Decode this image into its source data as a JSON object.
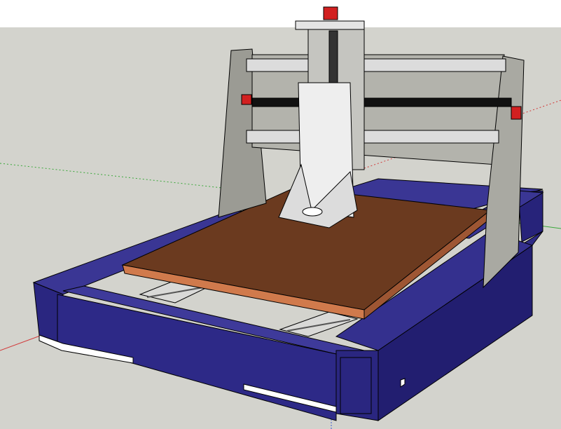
{
  "viewport": {
    "label": "",
    "sky_color": "#ffffff",
    "ground_color": "#d3d3cd"
  },
  "model": {
    "frame_color": "#2e2a85",
    "plate_color": "#6b3a1f",
    "gantry_color": "#a7a7a0",
    "rail_color": "#d9d9d7",
    "motor_color": "#d22020",
    "axes": {
      "x_color": "#d23b3b",
      "y_color": "#3aa83a",
      "z_color": "#3b5bd2"
    }
  }
}
